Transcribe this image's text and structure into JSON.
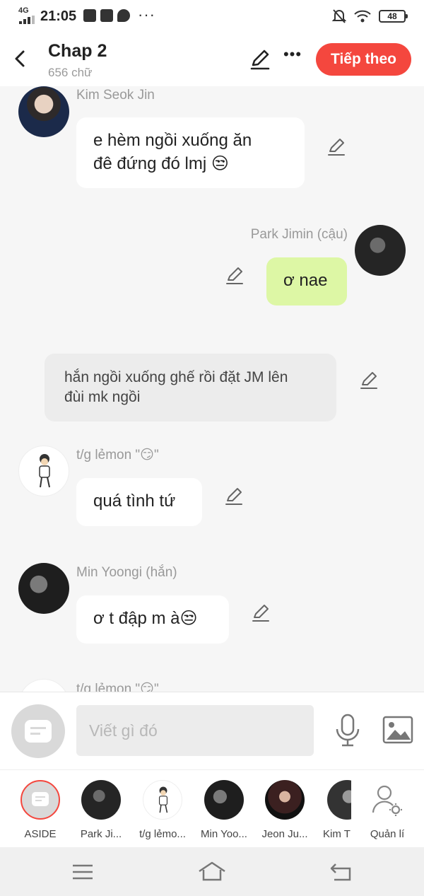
{
  "status_bar": {
    "network": "4G",
    "time": "21:05",
    "battery": "48"
  },
  "header": {
    "title": "Chap 2",
    "subtitle": "656 chữ",
    "next_label": "Tiếp theo"
  },
  "messages": [
    {
      "name": "Kim Seok Jin",
      "text_line1": "e hèm ngồi xuống ăn",
      "text_line2": "đê đứng đó lmj 😒"
    },
    {
      "name": "Park Jimin (cậu)",
      "text": "ơ nae"
    },
    {
      "text_line1": "hắn ngồi xuống ghế rồi đặt JM lên",
      "text_line2": "đùi mk ngồi"
    },
    {
      "name": "t/g lẻmon \"😏\"",
      "text": "quá tình tứ"
    },
    {
      "name": "Min Yoongi (hắn)",
      "text": "ơ t đập m à😒"
    },
    {
      "name": "t/g lẻmon \"😏\""
    }
  ],
  "input": {
    "placeholder": "Viết gì đó"
  },
  "characters": [
    {
      "label": "ASIDE"
    },
    {
      "label": "Park Ji..."
    },
    {
      "label": "t/g lẻmo..."
    },
    {
      "label": "Min Yoo..."
    },
    {
      "label": "Jeon Ju..."
    },
    {
      "label": "Kim T"
    },
    {
      "label": "Quản lí"
    }
  ],
  "colors": {
    "accent": "#f4473e",
    "self_bubble": "#ddf7a5",
    "narration": "#ececec",
    "background": "#f6f6f6"
  }
}
